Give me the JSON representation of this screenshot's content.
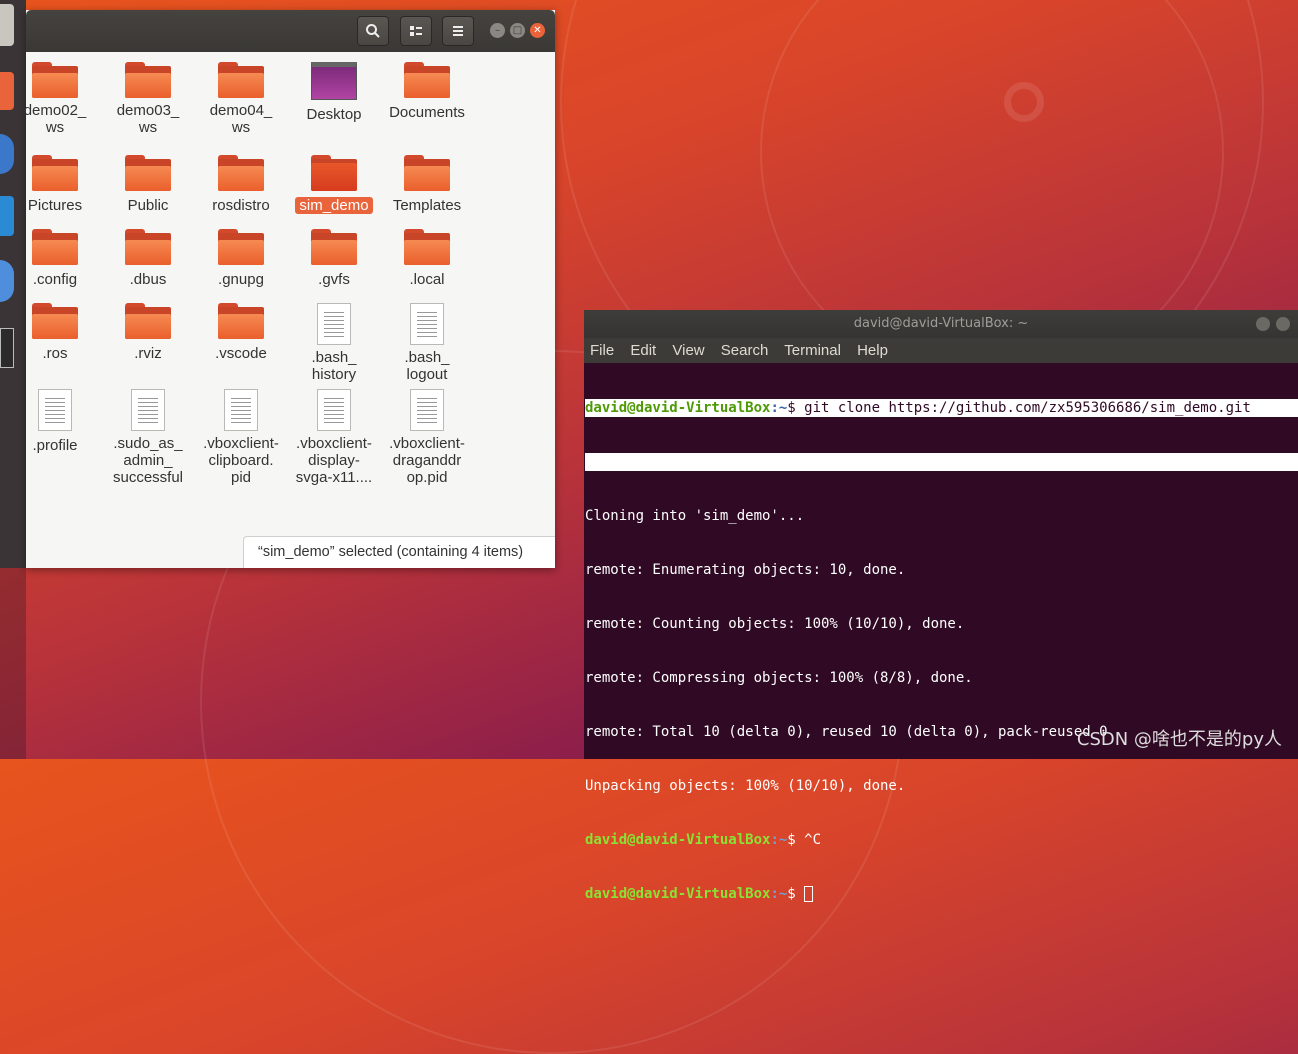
{
  "file_manager": {
    "header_buttons": {
      "search_icon": "search-icon",
      "view_icon": "list-view-icon",
      "menu_icon": "hamburger-menu-icon"
    },
    "items": [
      {
        "label": "demo02_\nws",
        "kind": "folder"
      },
      {
        "label": "demo03_\nws",
        "kind": "folder"
      },
      {
        "label": "demo04_\nws",
        "kind": "folder"
      },
      {
        "label": "Desktop",
        "kind": "desktop"
      },
      {
        "label": "Documents",
        "kind": "folder"
      },
      {
        "label": "Pictures",
        "kind": "folder"
      },
      {
        "label": "Public",
        "kind": "folder"
      },
      {
        "label": "rosdistro",
        "kind": "folder"
      },
      {
        "label": "sim_demo",
        "kind": "folder",
        "selected": true
      },
      {
        "label": "Templates",
        "kind": "folder"
      },
      {
        "label": ".config",
        "kind": "folder"
      },
      {
        "label": ".dbus",
        "kind": "folder"
      },
      {
        "label": ".gnupg",
        "kind": "folder"
      },
      {
        "label": ".gvfs",
        "kind": "folder"
      },
      {
        "label": ".local",
        "kind": "folder"
      },
      {
        "label": ".ros",
        "kind": "folder"
      },
      {
        "label": ".rviz",
        "kind": "folder"
      },
      {
        "label": ".vscode",
        "kind": "folder"
      },
      {
        "label": ".bash_\nhistory",
        "kind": "file"
      },
      {
        "label": ".bash_\nlogout",
        "kind": "file"
      },
      {
        "label": ".profile",
        "kind": "file"
      },
      {
        "label": ".sudo_as_\nadmin_\nsuccessful",
        "kind": "file"
      },
      {
        "label": ".vboxclient-\nclipboard.\npid",
        "kind": "file"
      },
      {
        "label": ".vboxclient-\ndisplay-\nsvga-x11....",
        "kind": "file"
      },
      {
        "label": ".vboxclient-\ndraganddr\nop.pid",
        "kind": "file"
      }
    ],
    "status": "“sim_demo” selected  (containing 4 items)"
  },
  "terminal": {
    "title": "david@david-VirtualBox: ~",
    "menu": [
      "File",
      "Edit",
      "View",
      "Search",
      "Terminal",
      "Help"
    ],
    "prompt_user": "david@david-VirtualBox",
    "prompt_path": ":~",
    "prompt_symbol": "$ ",
    "command": "git clone https://github.com/zx595306686/sim_demo.git",
    "output": [
      "Cloning into 'sim_demo'...",
      "remote: Enumerating objects: 10, done.",
      "remote: Counting objects: 100% (10/10), done.",
      "remote: Compressing objects: 100% (8/8), done.",
      "remote: Total 10 (delta 0), reused 10 (delta 0), pack-reused 0",
      "Unpacking objects: 100% (10/10), done."
    ],
    "second_command": "^C"
  },
  "watermark": "CSDN @啥也不是的py人"
}
